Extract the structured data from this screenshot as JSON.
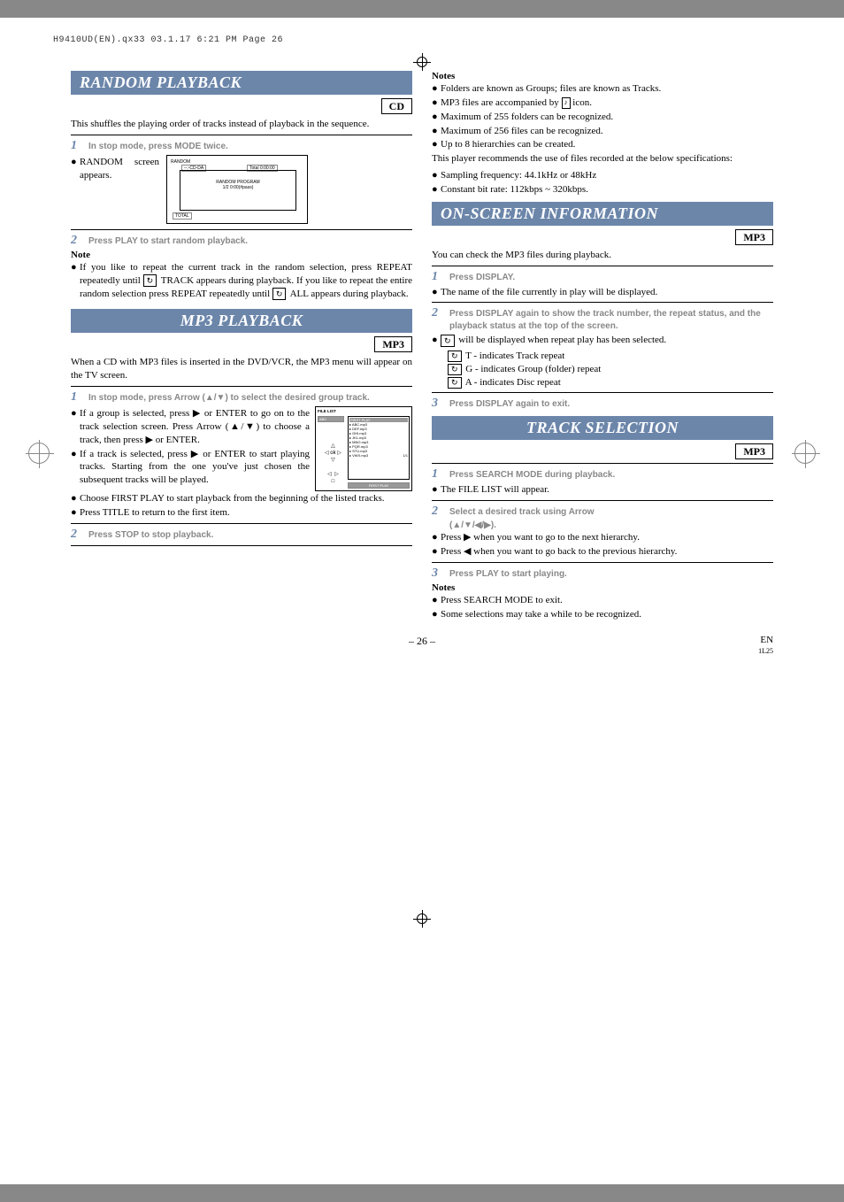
{
  "header_line": "H9410UD(EN).qx33  03.1.17 6:21 PM  Page 26",
  "left": {
    "random": {
      "title": "RANDOM PLAYBACK",
      "badge": "CD",
      "intro": "This shuffles the playing order of tracks instead of playback in the sequence.",
      "step1": "In stop mode, press MODE twice.",
      "bullet1": "RANDOM screen appears.",
      "fig": {
        "lbl": "RANDOM",
        "tab1": "--:-CD-DA",
        "tab2": "Total 0:00:00",
        "msg1": "RANDOM PROGRAM",
        "msg2": "1/2 0:00(#pass)",
        "total": "TOTAL"
      },
      "step2": "Press PLAY to start random playback.",
      "note_label": "Note",
      "note_text": "If you like to repeat the current track in the random selection, press REPEAT repeatedly until",
      "note_text2": " TRACK appears during playback. If you like to repeat the entire random selection press REPEAT repeatedly until ",
      "note_text3": " ALL appears during playback."
    },
    "mp3": {
      "title": "MP3 PLAYBACK",
      "badge": "MP3",
      "intro": "When a CD with MP3 files is inserted in the DVD/VCR, the MP3 menu will appear on the TV screen.",
      "step1": "In stop mode, press Arrow (▲/▼) to select the desired group track.",
      "b1a": "If a group is selected, press ▶ or ENTER to go on to the track selection screen. Press Arrow (▲/▼) to choose a track, then press ▶ or ENTER.",
      "b1b": "If a track is selected, press ▶ or ENTER to start playing tracks. Starting from the one you've just chosen the subsequent tracks will be played.",
      "b2": "Choose FIRST PLAY to start playback from the beginning of the listed tracks.",
      "b3": "Press TITLE to return to the first item.",
      "fig": {
        "title": "FILE LIST",
        "sel": "ABC",
        "hdr": "FIRST PLAY",
        "rows": [
          "▸ ABC.mp3",
          "▸ DEF.mp3",
          "▸ GHI.mp3",
          "▸ JKL.mp3",
          "▸ MNO.mp3",
          "▸ PQR.mp3",
          "▸ STU.mp3",
          "▸ VWX.mp3"
        ],
        "page": "1/1",
        "first": "FIRST PLAY"
      },
      "step2": "Press STOP to stop playback."
    }
  },
  "right": {
    "notes_label": "Notes",
    "notes": [
      "Folders are known as Groups; files are known as Tracks.",
      "MP3 files are accompanied by ",
      "Maximum of 255 folders can be recognized.",
      "Maximum of 256 files can be recognized.",
      "Up to 8 hierarchies can be created."
    ],
    "mp3_icon_text": "♪",
    "icon_suffix": " icon.",
    "rec_text": "This player recommends the use of files recorded at the below specifications:",
    "rec1": "Sampling frequency: 44.1kHz or 48kHz",
    "rec2": "Constant bit rate: 112kbps ~ 320kbps.",
    "onscreen": {
      "title": "ON-SCREEN INFORMATION",
      "badge": "MP3",
      "intro": "You can check the MP3 files during playback.",
      "step1": "Press DISPLAY.",
      "b1": "The name of the file currently in play will be displayed.",
      "step2": "Press DISPLAY again to show the track number, the repeat status, and the playback status at the top of the screen.",
      "repeat_pre": " will be displayed when repeat play has been selected.",
      "rt": " T - indicates Track repeat",
      "rg": " G - indicates Group (folder) repeat",
      "ra": " A - indicates Disc repeat",
      "step3": "Press DISPLAY again to exit."
    },
    "track": {
      "title": "TRACK SELECTION",
      "badge": "MP3",
      "step1": "Press SEARCH MODE during playback.",
      "b1": "The FILE LIST will appear.",
      "step2": "Select a desired track using Arrow",
      "step2b": "(▲/▼/◀/▶).",
      "b2": "Press ▶ when you want to go to the next hierarchy.",
      "b3": "Press ◀ when you want to go back to the previous hierarchy.",
      "step3": "Press PLAY to start playing.",
      "notes_label": "Notes",
      "n1": "Press SEARCH MODE to exit.",
      "n2": "Some selections may take a while to be recognized."
    }
  },
  "footer": {
    "page": "– 26 –",
    "lang": "EN",
    "code": "1L25"
  }
}
